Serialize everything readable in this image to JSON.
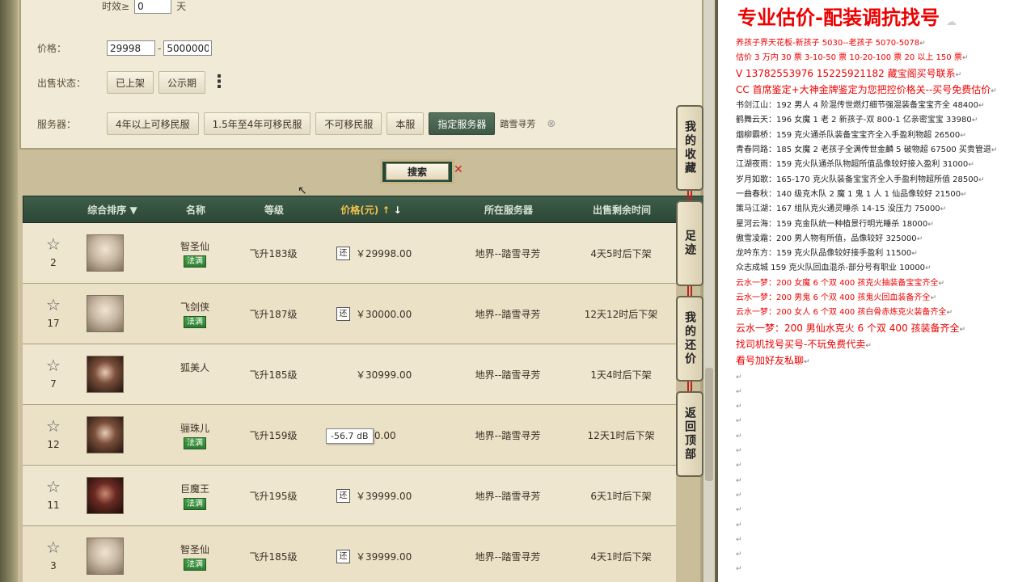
{
  "filter": {
    "shixiao_label": "时效≥",
    "shixiao_value": "0",
    "shixiao_unit": "天",
    "price_label": "价格：",
    "price_min": "29998",
    "price_sep": "-",
    "price_max": "5000000",
    "status_label": "出售状态：",
    "status_options": [
      "已上架",
      "公示期"
    ],
    "server_label": "服务器：",
    "server_options": [
      "4年以上可移民服",
      "1.5年至4年可移民服",
      "不可移民服",
      "本服",
      "指定服务器"
    ],
    "selected_server": "踏雪寻芳"
  },
  "search": {
    "label": "搜索"
  },
  "table": {
    "headers": {
      "sort": "综合排序",
      "name": "名称",
      "level": "等级",
      "price": "价格(元)",
      "server": "所在服务器",
      "time": "出售剩余时间"
    },
    "rows": [
      {
        "rank": "2",
        "name": "智圣仙",
        "tag": "法满",
        "level": "飞升183级",
        "huan": true,
        "price": "￥29998.00",
        "server": "地界--踏雪寻芳",
        "time": "4天5时后下架",
        "avatar": "light"
      },
      {
        "rank": "17",
        "name": "飞剑侠",
        "tag": "法满",
        "level": "飞升187级",
        "huan": true,
        "price": "￥30000.00",
        "server": "地界--踏雪寻芳",
        "time": "12天12时后下架",
        "avatar": "light"
      },
      {
        "rank": "7",
        "name": "狐美人",
        "tag": "",
        "level": "飞升185级",
        "huan": false,
        "price": "￥30999.00",
        "server": "地界--踏雪寻芳",
        "time": "1天4时后下架",
        "avatar": "dark"
      },
      {
        "rank": "12",
        "name": "骊珠儿",
        "tag": "法满",
        "level": "飞升159级",
        "huan": false,
        "price": "1000.00",
        "server": "地界--踏雪寻芳",
        "time": "12天1时后下架",
        "avatar": "dark"
      },
      {
        "rank": "11",
        "name": "巨魔王",
        "tag": "法满",
        "level": "飞升195级",
        "huan": true,
        "price": "￥39999.00",
        "server": "地界--踏雪寻芳",
        "time": "6天1时后下架",
        "avatar": "red"
      },
      {
        "rank": "3",
        "name": "智圣仙",
        "tag": "法满",
        "level": "飞升185级",
        "huan": true,
        "price": "￥39999.00",
        "server": "地界--踏雪寻芳",
        "time": "4天1时后下架",
        "avatar": "light"
      }
    ]
  },
  "tooltip": "-56.7 dB",
  "side_tabs": [
    "我的收藏",
    "足迹",
    "我的还价",
    "返回顶部"
  ],
  "notes": {
    "title": "专业估价-配装调抗找号",
    "lines": [
      {
        "t": "养孩子界天花板-新孩子 5030--老孩子 5070-5078",
        "red": true,
        "big": false
      },
      {
        "t": "估价 3 万内 30 票    3-10-50 票    10-20-100 票    20 以上 150 票",
        "red": true,
        "big": false
      },
      {
        "t": "V 13782553976    15225921182    藏宝阁买号联系",
        "red": true,
        "big": true
      },
      {
        "t": "CC 首席鉴定+大神金牌鉴定为您把控价格关--买号免费估价",
        "red": true,
        "big": true
      },
      {
        "t": "书剑江山：192 男人 4 阶混传世燃灯细节强混装备宝宝齐全 48400",
        "red": false,
        "big": false
      },
      {
        "t": "鹤舞云天：196 女魔 1 老 2 新孩子-双 800-1 亿亲密宝宝 33980",
        "red": false,
        "big": false
      },
      {
        "t": "烟柳霸桥：159 克火通杀队装备宝宝齐全入手盈利物超 26500",
        "red": false,
        "big": false
      },
      {
        "t": "青春同路：185 女魔 2 老孩子全满传世金麟 5 破物超 67500 买贵管退",
        "red": false,
        "big": false
      },
      {
        "t": "江湖夜雨：159 克火队通杀队物超所值品像较好接入盈利 31000",
        "red": false,
        "big": false
      },
      {
        "t": "岁月如歌：165-170 克火队装备宝宝齐全入手盈利物超所值 28500",
        "red": false,
        "big": false
      },
      {
        "t": "一曲春秋：140 级克木队 2 魔 1 鬼 1 人 1 仙品像较好 21500",
        "red": false,
        "big": false
      },
      {
        "t": "策马江湖：167 组队克火通灵睡杀 14-15 没压力 75000",
        "red": false,
        "big": false
      },
      {
        "t": "星河云海：159 克金队统一种植景行明光睡杀 18000",
        "red": false,
        "big": false
      },
      {
        "t": "傲雪凌霜：200 男人物有所值，品像较好 325000",
        "red": false,
        "big": false
      },
      {
        "t": "龙吟东方：159 克火队品像较好接手盈利 11500",
        "red": false,
        "big": false
      },
      {
        "t": "众志成城 159 克火队回血混杀-部分号有职业 10000",
        "red": false,
        "big": false
      },
      {
        "t": "云水一梦：200 女魔 6 个双 400 孩克火抽装备宝宝齐全",
        "red": true,
        "big": false
      },
      {
        "t": "云水一梦：200 男鬼 6 个双 400 孩鬼火回血装备齐全",
        "red": true,
        "big": false
      },
      {
        "t": "云水一梦：200 女人 6 个双 400 孩白骨赤炼克火装备齐全",
        "red": true,
        "big": false
      },
      {
        "t": "云水一梦：200 男仙水克火 6 个双 400 孩装备齐全",
        "red": true,
        "big": true
      },
      {
        "t": "找司机找号买号-不玩免费代卖",
        "red": true,
        "big": true
      },
      {
        "t": "看号加好友私聊",
        "red": true,
        "big": true
      }
    ],
    "blank_count": 14,
    "return_mark": "↵"
  }
}
